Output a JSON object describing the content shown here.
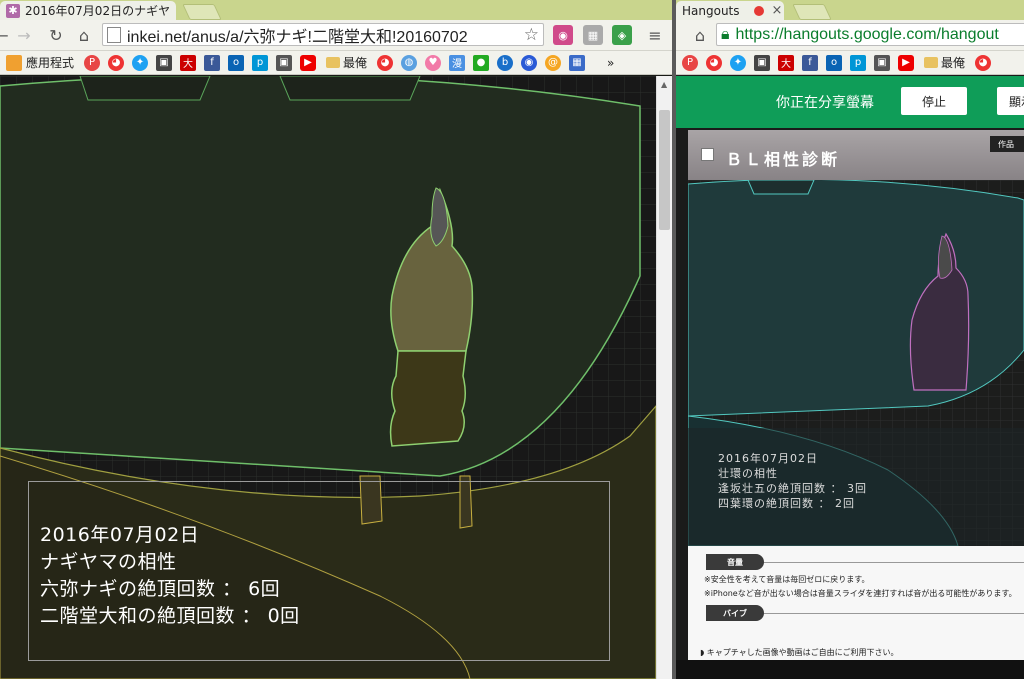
{
  "left_window": {
    "tab": {
      "title": "2016年07月02日のナギヤ",
      "close": "×"
    },
    "address": {
      "url": "inkei.net/anus/a/六弥ナギ!二階堂大和!20160702"
    },
    "bookmarks": {
      "apps_label": "應用程式",
      "folder_label": "最俺"
    },
    "result": {
      "date": "2016年07月02日",
      "pair": "ナギヤマの相性",
      "line1": "六弥ナギの絶頂回数 ： 6回",
      "line2": "二階堂大和の絶頂回数 ： 0回"
    }
  },
  "right_window": {
    "tab": {
      "title": "Hangouts",
      "close": "×"
    },
    "address": {
      "url": "https://hangouts.google.com/hangout"
    },
    "bookmarks": {
      "folder_label": "最俺"
    },
    "share_bar": {
      "text": "你正在分享螢幕",
      "stop_label": "停止",
      "show_label": "顯示"
    },
    "app": {
      "title": "ＢＬ相性診断",
      "tag": "作品",
      "result": {
        "date": "2016年07月02日",
        "pair": "壮環の相性",
        "line1": "逢坂壮五の絶頂回数 ： 3回",
        "line2": "四葉環の絶頂回数 ： 2回"
      },
      "volume_label": "音量",
      "vibe_label": "バイブ",
      "note1": "※安全性を考えて音量は毎回ゼロに戻ります。",
      "note2": "※iPhoneなど音が出ない場合は音量スライダを連打すれば音が出る可能性があります。",
      "footer": "キャプチャした画像や動画はご自由にご利用下さい。"
    }
  }
}
